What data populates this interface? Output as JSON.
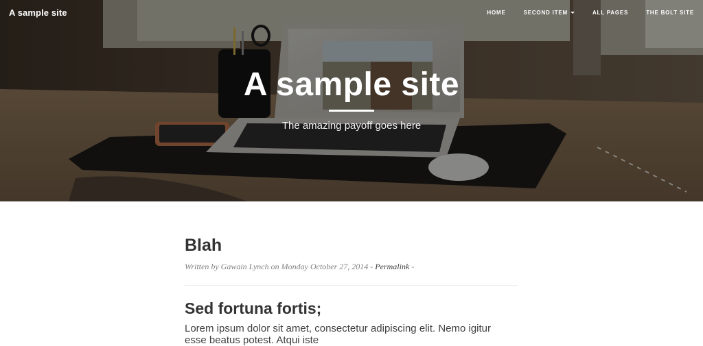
{
  "navbar": {
    "brand": "A sample site",
    "items": [
      {
        "label": "Home"
      },
      {
        "label": "Second item",
        "has_dropdown": true,
        "icon": "caret-down-icon"
      },
      {
        "label": "All pages"
      },
      {
        "label": "The Bolt site"
      }
    ]
  },
  "hero": {
    "title": "A sample site",
    "subtitle": "The amazing payoff goes here"
  },
  "post": {
    "title": "Blah",
    "meta_prefix": "Written by Gawain Lynch on Monday October 27, 2014 - ",
    "permalink": "Permalink",
    "meta_suffix": " -",
    "section_title": "Sed fortuna fortis;",
    "body_line_1": "Lorem ipsum dolor sit amet, consectetur adipiscing elit. Nemo igitur",
    "body_line_2": "esse beatus potest. Atqui iste"
  },
  "colors": {
    "text_dark": "#333333",
    "text_body": "#404040",
    "meta_gray": "#808080",
    "nav_text": "#ffffff"
  }
}
